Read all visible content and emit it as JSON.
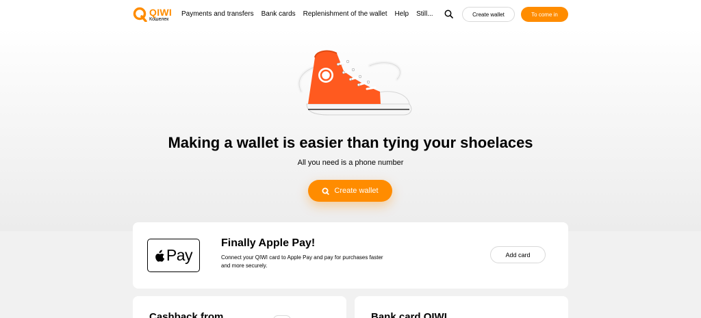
{
  "header": {
    "logo_word": "QIWI",
    "logo_sub": "Кошелек",
    "nav": [
      "Payments and transfers",
      "Bank cards",
      "Replenishment of the wallet",
      "Help",
      "Still..."
    ],
    "create_wallet": "Create wallet",
    "login": "To come in"
  },
  "hero": {
    "title": "Making a wallet is easier than tying your shoelaces",
    "subtitle": "All you need is a phone number",
    "cta": "Create wallet"
  },
  "apple_card": {
    "logo_text": "Pay",
    "title": "Finally Apple Pay!",
    "description": "Connect your QIWI card to Apple Pay and pay for purchases faster and more securely.",
    "button": "Add card"
  },
  "cards": {
    "cashback_title": "Cashback from",
    "bank_title": "Bank card QIWI"
  },
  "colors": {
    "brand": "#ff8c00",
    "background": "#f1f1f1"
  }
}
